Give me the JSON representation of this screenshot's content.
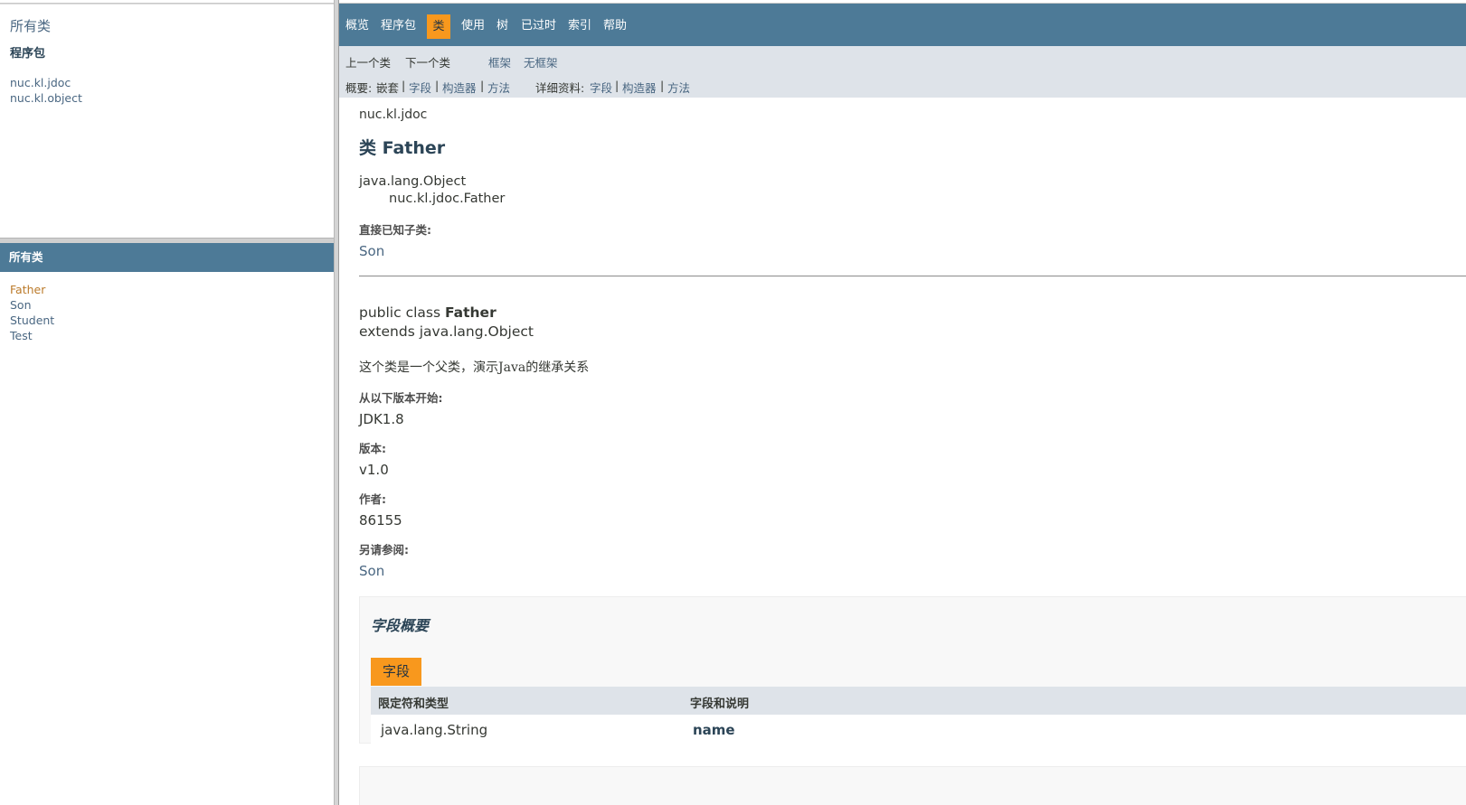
{
  "left_top": {
    "title": "所有类",
    "heading": "程序包",
    "packages": [
      "nuc.kl.jdoc",
      "nuc.kl.object"
    ]
  },
  "left_bottom": {
    "heading": "所有类",
    "classes": [
      {
        "label": "Father",
        "active": true
      },
      {
        "label": "Son",
        "active": false
      },
      {
        "label": "Student",
        "active": false
      },
      {
        "label": "Test",
        "active": false
      }
    ]
  },
  "topnav": {
    "items": [
      "概览",
      "程序包",
      "类",
      "使用",
      "树",
      "已过时",
      "索引",
      "帮助"
    ],
    "selected": "类"
  },
  "subnav": {
    "prev_class": "上一个类",
    "next_class": "下一个类",
    "frames": "框架",
    "no_frames": "无框架",
    "summary_label": "概要:",
    "summary_nested": "嵌套",
    "sep": "|",
    "summary_field": "字段",
    "summary_constructor": "构造器",
    "summary_method": "方法",
    "detail_label": "详细资料:",
    "detail_field": "字段",
    "detail_constructor": "构造器",
    "detail_method": "方法"
  },
  "class_page": {
    "package": "nuc.kl.jdoc",
    "title": "类 Father",
    "inheritance": [
      "java.lang.Object",
      "nuc.kl.jdoc.Father"
    ],
    "subclasses_label": "直接已知子类:",
    "subclasses": "Son",
    "decl_prefix": "public class ",
    "decl_name": "Father",
    "decl_extends": "extends java.lang.Object",
    "description": "这个类是一个父类，演示Java的继承关系",
    "since_label": "从以下版本开始:",
    "since": "JDK1.8",
    "version_label": "版本:",
    "version": "v1.0",
    "author_label": "作者:",
    "author": "86155",
    "see_label": "另请参阅:",
    "see": "Son"
  },
  "field_summary": {
    "title": "字段概要",
    "tab": "字段",
    "col1": "限定符和类型",
    "col2": "字段和说明",
    "rows": [
      {
        "type": "java.lang.String",
        "name": "name"
      }
    ]
  },
  "colors": {
    "nav_bg": "#4D7A97",
    "subnav_bg": "#DEE3E9",
    "accent": "#F8981D",
    "link": "#4A6782"
  }
}
